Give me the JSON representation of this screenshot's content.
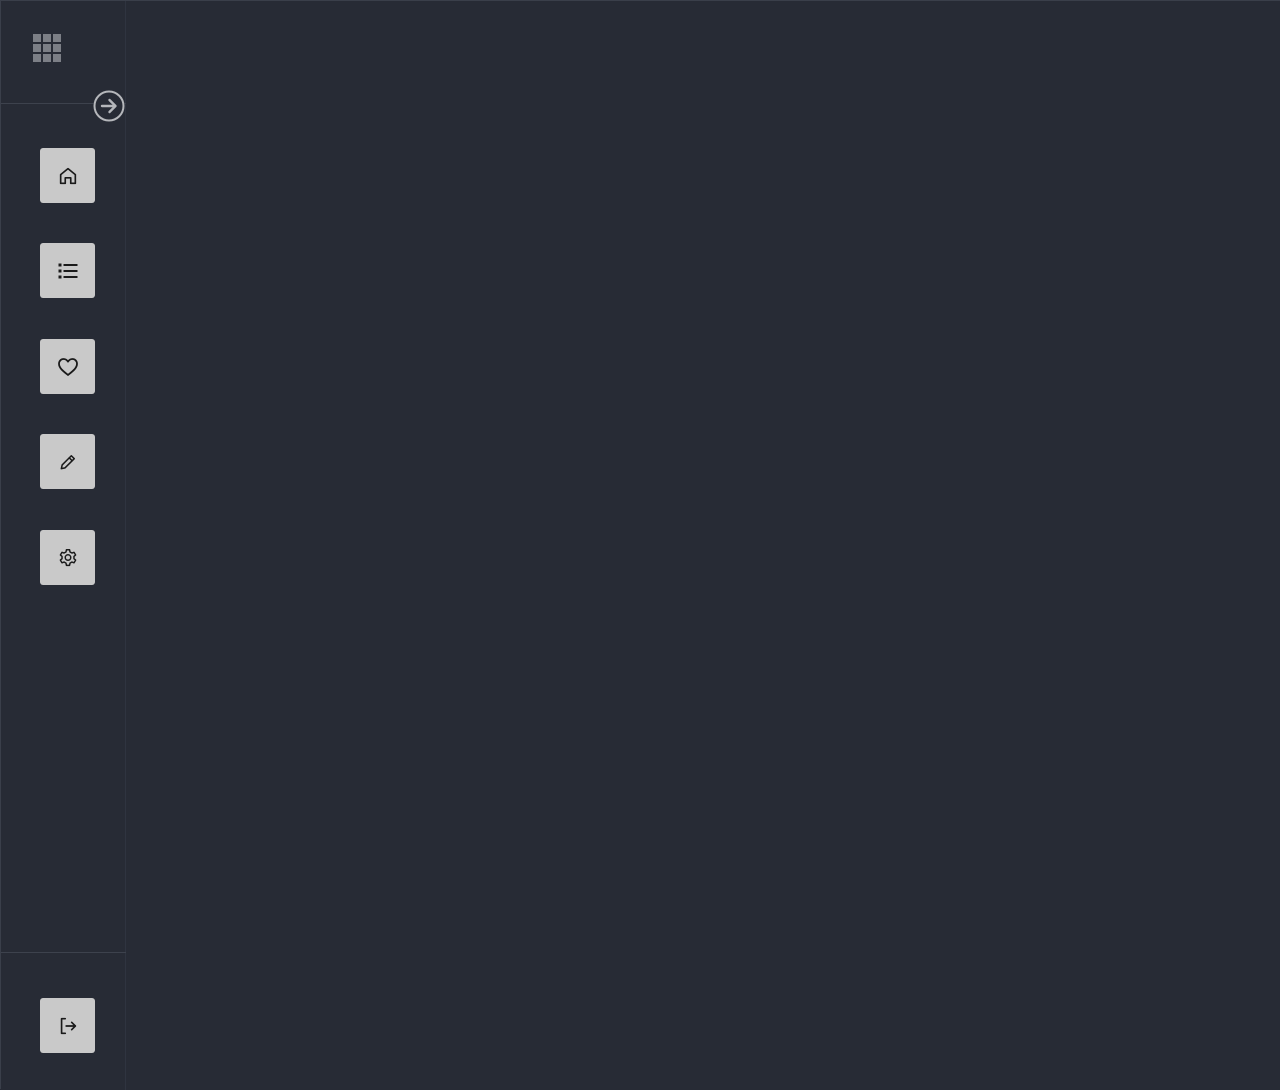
{
  "sidebar": {
    "logo_icon": "grid-icon",
    "collapse_icon": "arrow-right-circle-icon",
    "nav_items": [
      {
        "id": "home",
        "icon": "home-icon"
      },
      {
        "id": "list",
        "icon": "list-icon"
      },
      {
        "id": "favorites",
        "icon": "heart-icon"
      },
      {
        "id": "edit",
        "icon": "pencil-icon"
      },
      {
        "id": "settings",
        "icon": "gear-icon"
      }
    ],
    "logout_icon": "logout-icon"
  },
  "colors": {
    "background": "#272b35",
    "button": "#c9c9c9",
    "logo": "#7c7f86",
    "toggle": "#b5b7bb"
  }
}
